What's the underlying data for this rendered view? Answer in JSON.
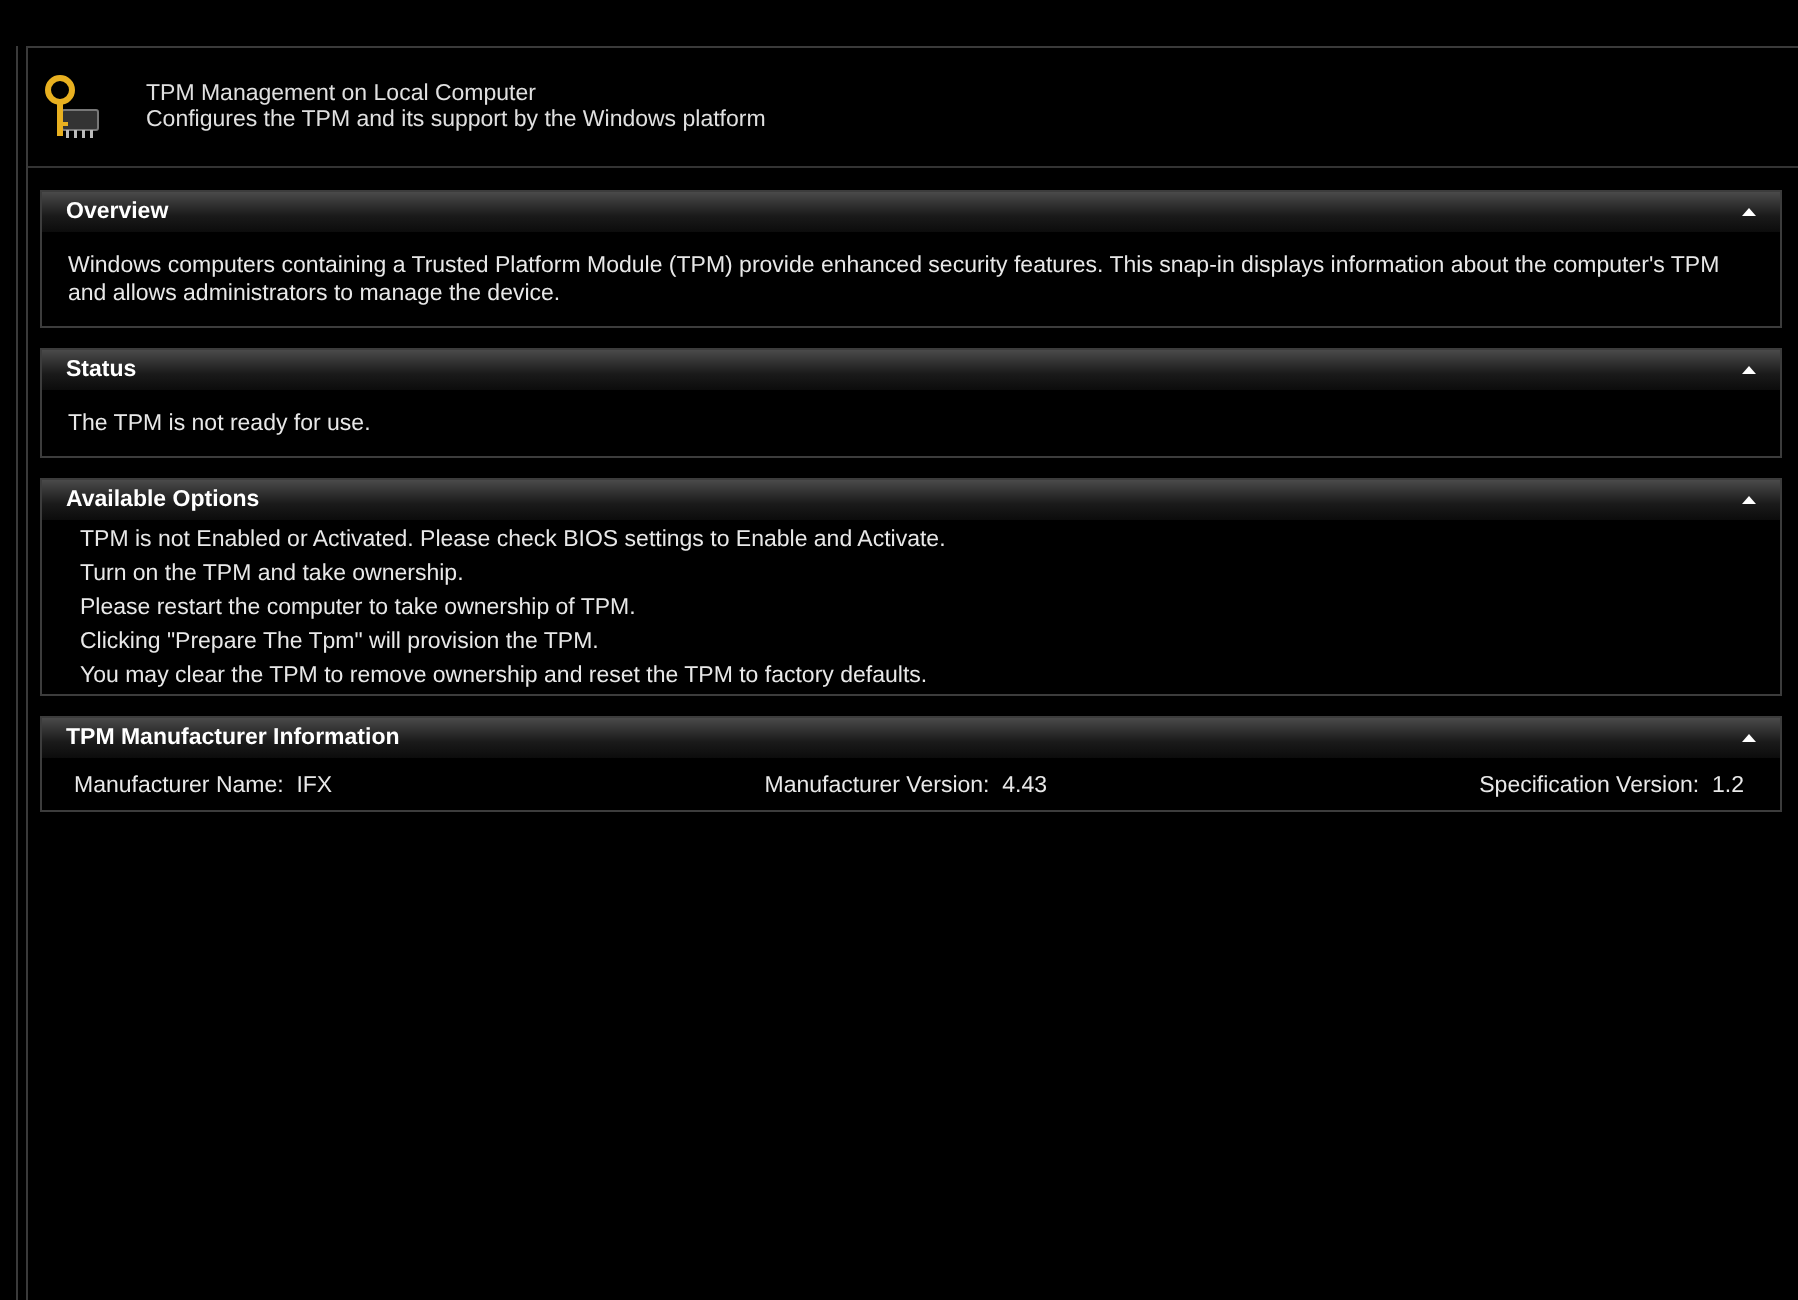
{
  "header": {
    "title": "TPM Management on Local Computer",
    "subtitle": "Configures the TPM and its support by the Windows platform"
  },
  "sections": [
    {
      "title": "Overview",
      "expanded": true,
      "kind": "paragraph",
      "text": "Windows computers containing a Trusted Platform Module (TPM) provide enhanced security features. This snap-in displays information about the computer's TPM and allows administrators to manage the device."
    },
    {
      "title": "Status",
      "expanded": true,
      "kind": "paragraph",
      "text": "The TPM is not ready for use."
    },
    {
      "title": "Available Options",
      "expanded": true,
      "kind": "list",
      "items": [
        "TPM is not Enabled or Activated. Please check BIOS settings to Enable and Activate.",
        "Turn on the TPM and take ownership.",
        "Please restart the computer to take ownership of TPM.",
        "Clicking \"Prepare The Tpm\" will provision the TPM.",
        "You may clear the TPM to remove ownership and reset the TPM to factory defaults."
      ]
    },
    {
      "title": "TPM Manufacturer Information",
      "expanded": true,
      "kind": "fields",
      "fields": [
        {
          "label": "Manufacturer Name:",
          "value": "IFX"
        },
        {
          "label": "Manufacturer Version:",
          "value": "4.43"
        },
        {
          "label": "Specification Version:",
          "value": "1.2"
        }
      ]
    }
  ]
}
